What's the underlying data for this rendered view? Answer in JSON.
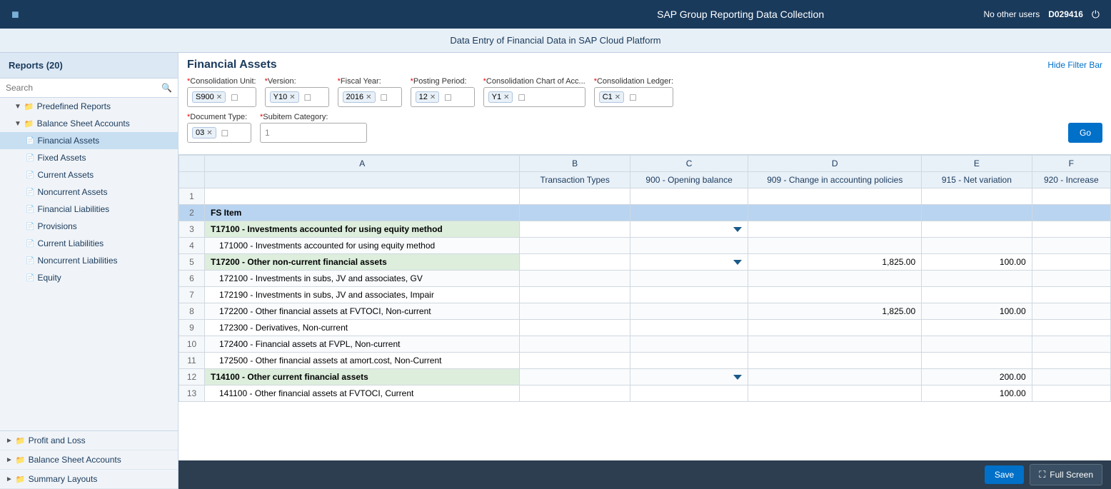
{
  "app": {
    "title": "SAP Group Reporting Data Collection",
    "subtitle": "Data Entry of Financial Data in SAP Cloud Platform",
    "user": "D029416",
    "no_other_users": "No other users"
  },
  "sidebar": {
    "title": "Reports (20)",
    "search_placeholder": "Search",
    "tree": [
      {
        "id": "predefined",
        "label": "Predefined Reports",
        "level": 0,
        "type": "folder",
        "expanded": true
      },
      {
        "id": "balance-sheet",
        "label": "Balance Sheet Accounts",
        "level": 1,
        "type": "folder",
        "expanded": true
      },
      {
        "id": "financial-assets",
        "label": "Financial Assets",
        "level": 2,
        "type": "page",
        "active": true
      },
      {
        "id": "fixed-assets",
        "label": "Fixed Assets",
        "level": 2,
        "type": "page"
      },
      {
        "id": "current-assets",
        "label": "Current Assets",
        "level": 2,
        "type": "page"
      },
      {
        "id": "noncurrent-assets",
        "label": "Noncurrent Assets",
        "level": 2,
        "type": "page"
      },
      {
        "id": "financial-liabilities",
        "label": "Financial Liabilities",
        "level": 2,
        "type": "page"
      },
      {
        "id": "provisions",
        "label": "Provisions",
        "level": 2,
        "type": "page"
      },
      {
        "id": "current-liabilities",
        "label": "Current Liabilities",
        "level": 2,
        "type": "page"
      },
      {
        "id": "noncurrent-liabilities",
        "label": "Noncurrent Liabilities",
        "level": 2,
        "type": "page"
      },
      {
        "id": "equity",
        "label": "Equity",
        "level": 2,
        "type": "page"
      }
    ],
    "bottom": [
      {
        "id": "profit-loss",
        "label": "Profit and Loss",
        "level": 0,
        "type": "folder",
        "expanded": false
      },
      {
        "id": "balance-sheet2",
        "label": "Balance Sheet Accounts",
        "level": 0,
        "type": "folder",
        "expanded": false
      },
      {
        "id": "summary-layouts",
        "label": "Summary Layouts",
        "level": 0,
        "type": "folder"
      }
    ]
  },
  "filter_bar": {
    "page_title": "Financial Assets",
    "hide_filter_label": "Hide Filter Bar",
    "fields": [
      {
        "id": "consolidation_unit",
        "label": "Consolidation Unit:",
        "required": true,
        "value": "S900"
      },
      {
        "id": "version",
        "label": "Version:",
        "required": true,
        "value": "Y10"
      },
      {
        "id": "fiscal_year",
        "label": "Fiscal Year:",
        "required": true,
        "value": "2016"
      },
      {
        "id": "posting_period",
        "label": "Posting Period:",
        "required": true,
        "value": "12"
      },
      {
        "id": "consolidation_chart",
        "label": "Consolidation Chart of Acc...",
        "required": true,
        "value": "Y1"
      },
      {
        "id": "consolidation_ledger",
        "label": "Consolidation Ledger:",
        "required": true,
        "value": "C1"
      }
    ],
    "fields2": [
      {
        "id": "document_type",
        "label": "Document Type:",
        "required": true,
        "value": "03"
      },
      {
        "id": "subitem_category",
        "label": "Subitem Category:",
        "required": true,
        "value": "1"
      }
    ],
    "go_label": "Go"
  },
  "grid": {
    "columns": [
      {
        "id": "row_num",
        "label": ""
      },
      {
        "id": "A",
        "label": "A"
      },
      {
        "id": "B",
        "label": "B"
      },
      {
        "id": "C",
        "label": "C"
      },
      {
        "id": "D",
        "label": "D"
      },
      {
        "id": "E",
        "label": "E"
      },
      {
        "id": "F",
        "label": "F"
      }
    ],
    "col_headers": {
      "B": "Transaction Types",
      "C": "900 - Opening balance",
      "D": "909 - Change in accounting policies",
      "E": "915 - Net variation",
      "F": "920 - Increase"
    },
    "rows": [
      {
        "num": 1,
        "a": "",
        "b": "",
        "c": "",
        "d": "",
        "e": "",
        "f": "",
        "type": "header_row"
      },
      {
        "num": 2,
        "a": "FS Item",
        "b": "",
        "c": "",
        "d": "",
        "e": "",
        "f": "",
        "type": "fs_header"
      },
      {
        "num": 3,
        "a": "T17100 - Investments accounted for using equity method",
        "b": "",
        "c": "",
        "d": "",
        "e": "",
        "f": "",
        "type": "group",
        "has_triangle_c": true
      },
      {
        "num": 4,
        "a": "171000 - Investments accounted for using equity method",
        "b": "",
        "c": "",
        "d": "",
        "e": "",
        "f": "",
        "type": "item"
      },
      {
        "num": 5,
        "a": "T17200 - Other non-current financial assets",
        "b": "",
        "c": "",
        "d": "1,825.00",
        "e": "100.00",
        "f": "",
        "type": "group",
        "has_triangle_c": true
      },
      {
        "num": 6,
        "a": "172100 - Investments in subs, JV and associates, GV",
        "b": "",
        "c": "",
        "d": "",
        "e": "",
        "f": "",
        "type": "item"
      },
      {
        "num": 7,
        "a": "172190 - Investments in subs, JV and associates, Impair",
        "b": "",
        "c": "",
        "d": "",
        "e": "",
        "f": "",
        "type": "item"
      },
      {
        "num": 8,
        "a": "172200 - Other financial assets at FVTOCI, Non-current",
        "b": "",
        "c": "",
        "d": "1,825.00",
        "e": "100.00",
        "f": "",
        "type": "item"
      },
      {
        "num": 9,
        "a": "172300 - Derivatives, Non-current",
        "b": "",
        "c": "",
        "d": "",
        "e": "",
        "f": "",
        "type": "item"
      },
      {
        "num": 10,
        "a": "172400 - Financial assets at FVPL, Non-current",
        "b": "",
        "c": "",
        "d": "",
        "e": "",
        "f": "",
        "type": "item"
      },
      {
        "num": 11,
        "a": "172500 - Other financial assets at amort.cost, Non-Current",
        "b": "",
        "c": "",
        "d": "",
        "e": "",
        "f": "",
        "type": "item"
      },
      {
        "num": 12,
        "a": "T14100 - Other current financial assets",
        "b": "",
        "c": "",
        "d": "",
        "e": "200.00",
        "f": "",
        "type": "group",
        "has_triangle_c": true
      },
      {
        "num": 13,
        "a": "141100 - Other financial assets at FVTOCI, Current",
        "b": "",
        "c": "",
        "d": "",
        "e": "100.00",
        "f": "",
        "type": "item"
      }
    ]
  },
  "bottom_bar": {
    "save_label": "Save",
    "fullscreen_label": "Full Screen"
  }
}
